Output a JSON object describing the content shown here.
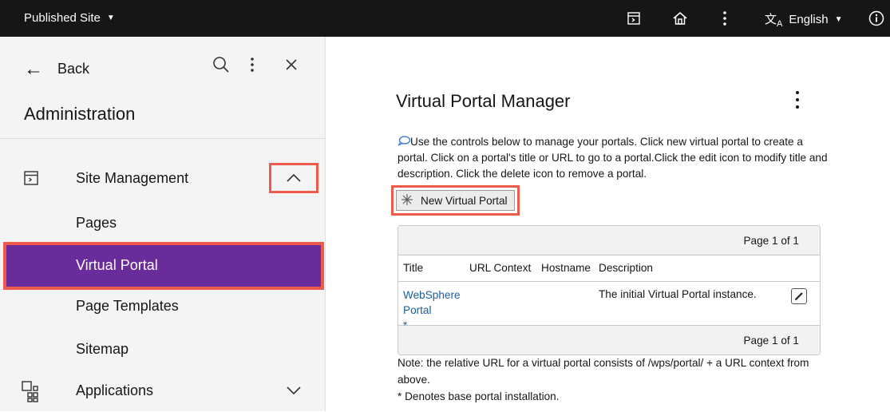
{
  "topbar": {
    "site_label": "Published Site",
    "language": "English",
    "icons": [
      "site-panel-icon",
      "home-icon",
      "kebab-icon",
      "translate-icon",
      "info-icon"
    ]
  },
  "sidebar": {
    "back_label": "Back",
    "title": "Administration",
    "items": [
      {
        "label": "Site Management",
        "icon": "site-panel-icon",
        "expanded": true
      },
      {
        "label": "Pages"
      },
      {
        "label": "Virtual Portal",
        "active": true
      },
      {
        "label": "Page Templates"
      },
      {
        "label": "Sitemap"
      },
      {
        "label": "Applications",
        "icon": "applications-grid-icon",
        "expanded": false
      }
    ]
  },
  "main": {
    "title": "Virtual Portal Manager",
    "description": "Use the controls below to manage your portals. Click new virtual portal to create a portal. Click on a portal's title or URL to go to a portal.Click the edit icon to modify title and description. Click the delete icon to remove a portal.",
    "new_button_label": "New Virtual Portal",
    "table": {
      "pager_top": "Page 1 of 1",
      "pager_bottom": "Page 1 of 1",
      "columns": [
        "Title",
        "URL Context",
        "Hostname",
        "Description"
      ],
      "rows": [
        {
          "title_line1": "WebSphere",
          "title_line2": "Portal *",
          "url_context": "",
          "hostname": "",
          "description": "The initial Virtual Portal instance."
        }
      ]
    },
    "note_line1": "Note: the relative URL for a virtual portal consists of /wps/portal/ + a URL context from above.",
    "note_line2": "* Denotes base portal installation."
  },
  "colors": {
    "topbar_bg": "#161616",
    "sidebar_bg": "#f4f4f4",
    "active_item_bg": "#6b2c9b",
    "highlight_border": "#ee5a4b",
    "link": "#1a5e9a"
  }
}
